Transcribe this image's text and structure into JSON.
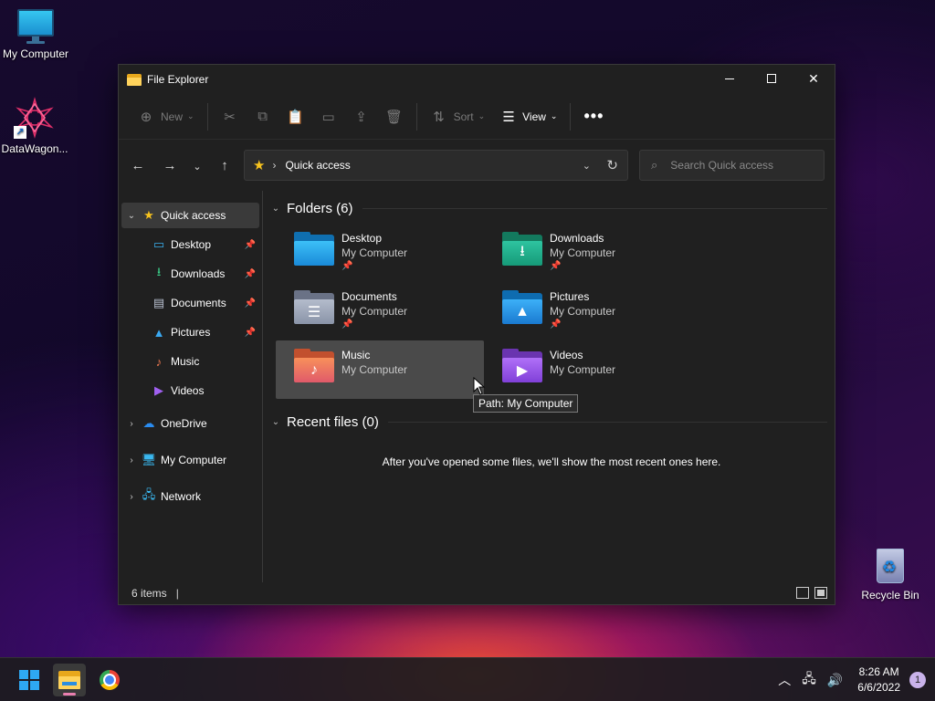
{
  "desktop": {
    "icons": [
      {
        "label": "My Computer"
      },
      {
        "label": "DataWagon..."
      },
      {
        "label": "Recycle Bin"
      }
    ]
  },
  "window": {
    "title": "File Explorer",
    "toolbar": {
      "new_label": "New",
      "sort_label": "Sort",
      "view_label": "View",
      "more_label": "•••"
    },
    "address": {
      "path": "Quick access"
    },
    "search": {
      "placeholder": "Search Quick access"
    },
    "sidebar": {
      "quick_access": "Quick access",
      "pinned": [
        {
          "label": "Desktop",
          "pinned": true
        },
        {
          "label": "Downloads",
          "pinned": true
        },
        {
          "label": "Documents",
          "pinned": true
        },
        {
          "label": "Pictures",
          "pinned": true
        },
        {
          "label": "Music",
          "pinned": false
        },
        {
          "label": "Videos",
          "pinned": false
        }
      ],
      "groups": [
        {
          "label": "OneDrive"
        },
        {
          "label": "My Computer"
        },
        {
          "label": "Network"
        }
      ]
    },
    "folders_section": {
      "heading": "Folders (6)",
      "items": [
        {
          "name": "Desktop",
          "location": "My Computer",
          "pinned": true,
          "color": "#1e90d8"
        },
        {
          "name": "Downloads",
          "location": "My Computer",
          "pinned": true,
          "color": "#1f9e7a"
        },
        {
          "name": "Documents",
          "location": "My Computer",
          "pinned": true,
          "color": "#8a94a8"
        },
        {
          "name": "Pictures",
          "location": "My Computer",
          "pinned": true,
          "color": "#1a8ad6"
        },
        {
          "name": "Music",
          "location": "My Computer",
          "pinned": false,
          "color": "#e8704a"
        },
        {
          "name": "Videos",
          "location": "My Computer",
          "pinned": false,
          "color": "#8a4ad8"
        }
      ]
    },
    "recent_section": {
      "heading": "Recent files (0)",
      "empty_message": "After you've opened some files, we'll show the most recent ones here."
    },
    "status": {
      "item_count": "6 items"
    },
    "tooltip": "Path: My Computer"
  },
  "taskbar": {
    "time": "8:26 AM",
    "date": "6/6/2022",
    "notification_count": "1"
  }
}
